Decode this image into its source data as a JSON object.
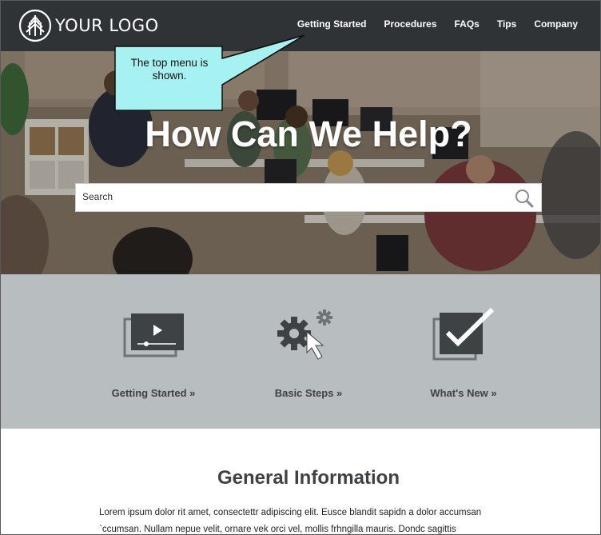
{
  "header": {
    "logo_text": "YOUR LOGO",
    "nav": [
      {
        "label": "Getting Started"
      },
      {
        "label": "Procedures"
      },
      {
        "label": "FAQs"
      },
      {
        "label": "Tips"
      },
      {
        "label": "Company"
      }
    ]
  },
  "callout": {
    "text": "The top menu is shown."
  },
  "hero": {
    "title": "How Can We Help?",
    "search_placeholder": "Search"
  },
  "features": [
    {
      "label": "Getting Started »",
      "icon": "video-player-icon"
    },
    {
      "label": "Basic Steps »",
      "icon": "gears-cursor-icon"
    },
    {
      "label": "What's New »",
      "icon": "checkmark-icon"
    }
  ],
  "info": {
    "title": "General Information",
    "body": "Lorem ipsum dolor rit amet, consectettr adipiscing elit. Eusce blandit sapidn a dolor accumsan `ccumsan. Nullam nepue velit, ornare vek orci vel, mollis frhngilla mauris. Dondc sagittis"
  },
  "colors": {
    "header_bg": "#2f3336",
    "features_bg": "#b8bdc0",
    "callout_fill": "#a6f1f1",
    "icon_dark": "#3e4245"
  }
}
